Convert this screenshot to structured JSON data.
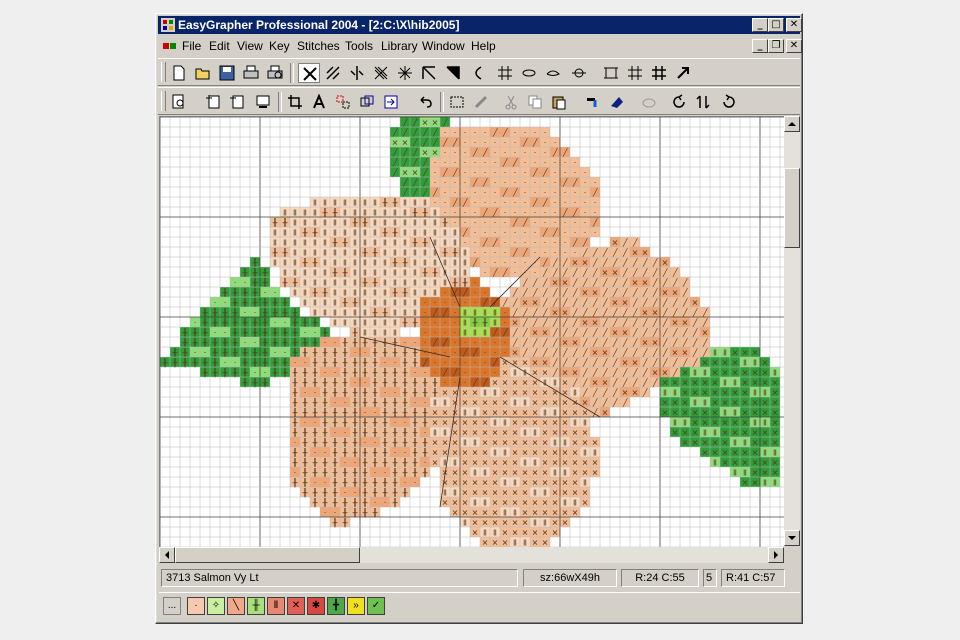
{
  "window": {
    "title": "EasyGrapher Professional 2004 - [2:C:\\X\\hib2005]",
    "controls": {
      "minimize": "_",
      "maximize": "□",
      "close": "✕"
    }
  },
  "menu": {
    "items": [
      "File",
      "Edit",
      "View",
      "Key",
      "Stitches",
      "Tools",
      "Library",
      "Window",
      "Help"
    ],
    "mdi_controls": {
      "minimize": "_",
      "restore": "❐",
      "close": "✕"
    }
  },
  "toolbar1": {
    "icons": [
      "new-file-icon",
      "open-folder-icon",
      "save-icon",
      "print-icon",
      "print-preview-icon",
      "full-cross-stitch-icon",
      "half-cross-icon",
      "quarter-stitch-icon",
      "three-quarter-stitch-icon",
      "star-stitch-icon",
      "corner-stitch-icon",
      "corner-stitch-alt-icon",
      "arc-stitch-icon",
      "grid-stitch-icon",
      "oval-stitch-icon",
      "oval-stitch-alt-icon",
      "bead-icon",
      "frame-icon",
      "grid-icon",
      "grid-alt-icon",
      "arrow-icon"
    ]
  },
  "toolbar2": {
    "icons": [
      "zoom-page-icon",
      "zoom-in-icon",
      "zoom-out-icon",
      "monitor-icon",
      "crop-icon",
      "text-icon",
      "select-icon",
      "transform-icon",
      "export-icon",
      "undo-icon",
      "select-rect-icon",
      "paint-brush-icon",
      "cut-icon",
      "copy-icon",
      "paste-icon",
      "fill-bucket-icon",
      "swap-colour-icon",
      "palette-icon",
      "rotate-icon",
      "flip-icon",
      "redo-icon"
    ]
  },
  "status": {
    "colour_name": "3713  Salmon Vy Lt",
    "size": "sz:66wX49h",
    "cursor": "R:24 C:55",
    "count": "5",
    "position": "R:41 C:57"
  },
  "palette": {
    "more_label": "...",
    "swatches": [
      {
        "symbol": "·",
        "color": "#f7c9b0"
      },
      {
        "symbol": "✧",
        "color": "#c8f0a0"
      },
      {
        "symbol": "╲",
        "color": "#f2a98a"
      },
      {
        "symbol": "╫",
        "color": "#a8e07a"
      },
      {
        "symbol": "Ⅱ",
        "color": "#e98870"
      },
      {
        "symbol": "✕",
        "color": "#e06058"
      },
      {
        "symbol": "✱",
        "color": "#d94840"
      },
      {
        "symbol": "╋",
        "color": "#4fa84a"
      },
      {
        "symbol": "»",
        "color": "#f0e020"
      },
      {
        "symbol": "✓",
        "color": "#6ec050"
      }
    ]
  },
  "colors": {
    "titlebar": "#0a246a",
    "petal_light": "#f7d9bf",
    "petal_mid": "#f2be98",
    "petal_dark": "#eea676",
    "center": "#d9762c",
    "leaf_light": "#8fdc7a",
    "leaf_dark": "#2f9e3a"
  }
}
